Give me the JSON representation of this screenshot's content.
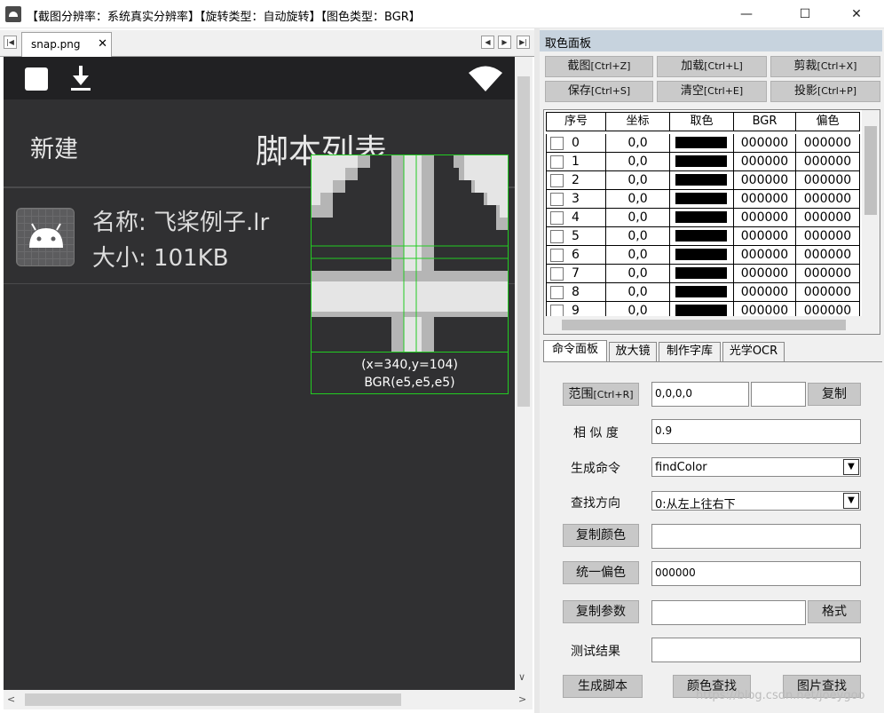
{
  "window": {
    "title": "【截图分辨率：系统真实分辨率】【旋转类型：自动旋转】【图色类型：BGR】",
    "minimize": "—",
    "maximize": "☐",
    "close": "✕"
  },
  "left_tabs": {
    "active_tab": "snap.png",
    "close_glyph": "✕",
    "nav": [
      "◀",
      "▶",
      "▶|",
      "|◀"
    ]
  },
  "phone": {
    "new_label": "新建",
    "title": "脚本列表",
    "item": {
      "name": "名称: 飞桨例子.lr",
      "size": "大小: 101KB"
    }
  },
  "magnifier": {
    "coords": "(x=340,y=104)",
    "color": "BGR(e5,e5,e5)"
  },
  "color_panel": {
    "title": "取色面板",
    "buttons": [
      {
        "label": "截图",
        "shortcut": "[Ctrl+Z]"
      },
      {
        "label": "加载",
        "shortcut": "[Ctrl+L]"
      },
      {
        "label": "剪裁",
        "shortcut": "[Ctrl+X]"
      },
      {
        "label": "保存",
        "shortcut": "[Ctrl+S]"
      },
      {
        "label": "清空",
        "shortcut": "[Ctrl+E]"
      },
      {
        "label": "投影",
        "shortcut": "[Ctrl+P]"
      }
    ],
    "table": {
      "headers": [
        "序号",
        "坐标",
        "取色",
        "BGR",
        "偏色"
      ],
      "rows": [
        {
          "index": "0",
          "coord": "0,0",
          "bgr": "000000",
          "offset": "000000"
        },
        {
          "index": "1",
          "coord": "0,0",
          "bgr": "000000",
          "offset": "000000"
        },
        {
          "index": "2",
          "coord": "0,0",
          "bgr": "000000",
          "offset": "000000"
        },
        {
          "index": "3",
          "coord": "0,0",
          "bgr": "000000",
          "offset": "000000"
        },
        {
          "index": "4",
          "coord": "0,0",
          "bgr": "000000",
          "offset": "000000"
        },
        {
          "index": "5",
          "coord": "0,0",
          "bgr": "000000",
          "offset": "000000"
        },
        {
          "index": "6",
          "coord": "0,0",
          "bgr": "000000",
          "offset": "000000"
        },
        {
          "index": "7",
          "coord": "0,0",
          "bgr": "000000",
          "offset": "000000"
        },
        {
          "index": "8",
          "coord": "0,0",
          "bgr": "000000",
          "offset": "000000"
        },
        {
          "index": "9",
          "coord": "0,0",
          "bgr": "000000",
          "offset": "000000"
        }
      ]
    }
  },
  "command_tabs": [
    "命令面板",
    "放大镜",
    "制作字库",
    "光学OCR"
  ],
  "command_panel": {
    "range_button": {
      "label": "范围",
      "shortcut": "[Ctrl+R]"
    },
    "range_value": "0,0,0,0",
    "range_extra": "",
    "copy_label": "复制",
    "similarity_label": "相 似 度",
    "similarity_value": "0.9",
    "gen_cmd_label": "生成命令",
    "gen_cmd_value": "findColor",
    "find_dir_label": "查找方向",
    "find_dir_value": "0:从左上往右下",
    "copy_color_label": "复制颜色",
    "copy_color_value": "",
    "unify_offset_label": "统一偏色",
    "unify_offset_value": "000000",
    "copy_params_label": "复制参数",
    "copy_params_value": "",
    "format_label": "格式",
    "test_result_label": "测试结果",
    "test_result_value": "",
    "gen_script_label": "生成脚本",
    "color_find_label": "颜色查找",
    "image_find_label": "图片查找"
  },
  "watermark": "https://blog.csdn.net/joeygoo",
  "colors": {
    "phone_bg": "#303032",
    "status_bar": "#212123",
    "magnifier_border": "#22cc22",
    "panel_header": "#c7d3de"
  }
}
